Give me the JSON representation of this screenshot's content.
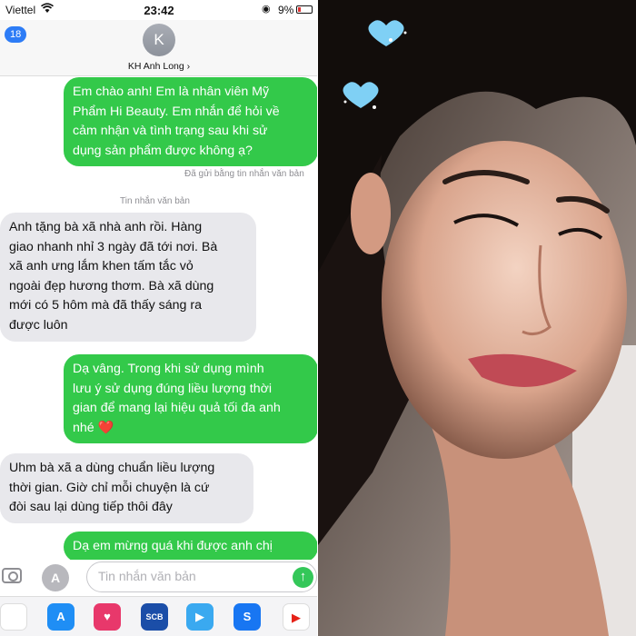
{
  "status_bar": {
    "carrier": "Viettel",
    "time": "23:42",
    "battery": "9%"
  },
  "header": {
    "back_count": "18",
    "avatar_initial": "K",
    "contact_name": "KH Anh Long ›"
  },
  "conversation": {
    "messages": [
      {
        "dir": "out",
        "lines": [
          "Em chào anh! Em là nhân viên Mỹ",
          "Phẩm Hi Beauty. Em nhắn để hỏi về",
          "cảm nhận và tình trạng sau khi sử",
          "dụng sản phẩm được không ạ?"
        ]
      },
      {
        "dir": "in",
        "lines": [
          "Anh tặng bà xã nhà anh rồi. Hàng",
          "giao nhanh nhỉ 3 ngày đã tới nơi. Bà",
          "xã anh ưng lắm khen tấm tắc vỏ",
          "ngoài đẹp hương thơm. Bà xã dùng",
          "mới có 5 hôm mà đã thấy sáng ra",
          "được luôn"
        ]
      },
      {
        "dir": "out",
        "lines": [
          "Dạ vâng. Trong khi sử dụng mình",
          "lưu ý sử dụng đúng liều lượng thời",
          "gian để mang lại hiệu quả tối đa anh",
          "nhé ❤️"
        ]
      },
      {
        "dir": "in",
        "lines": [
          "Uhm bà xã a dùng chuẩn liều lượng",
          "thời gian. Giờ chỉ mỗi chuyện là cứ",
          "đòi sau lại dùng tiếp thôi đây"
        ]
      },
      {
        "dir": "out",
        "lines": [
          "Dạ em mừng quá khi được anh chị"
        ]
      }
    ],
    "sent_as_text_note": "Đã gửi bằng tin nhắn văn bản",
    "text_message_label": "Tin nhắn văn bản"
  },
  "composer": {
    "placeholder": "Tin nhắn văn bản",
    "send_icon": "↑",
    "apps_icon": "A"
  },
  "app_drawer": {
    "apps": [
      {
        "name": "photos-app-icon",
        "label": "",
        "color": "#ffffff"
      },
      {
        "name": "app-store-icon",
        "label": "A",
        "color": "#1f8ef5"
      },
      {
        "name": "heart-app-icon",
        "label": "♥",
        "color": "#e8386b"
      },
      {
        "name": "scb-app-icon",
        "label": "SCB",
        "color": "#1b4ea8"
      },
      {
        "name": "video-app-icon",
        "label": "▶",
        "color": "#3aa9f0"
      },
      {
        "name": "shazam-app-icon",
        "label": "S",
        "color": "#1876f2"
      },
      {
        "name": "youtube-app-icon",
        "label": "▶",
        "color": "#ffffff"
      }
    ]
  },
  "colors": {
    "outgoing_bubble": "#33c94a",
    "incoming_bubble": "#e8e8ec",
    "badge": "#2d7cf6"
  }
}
